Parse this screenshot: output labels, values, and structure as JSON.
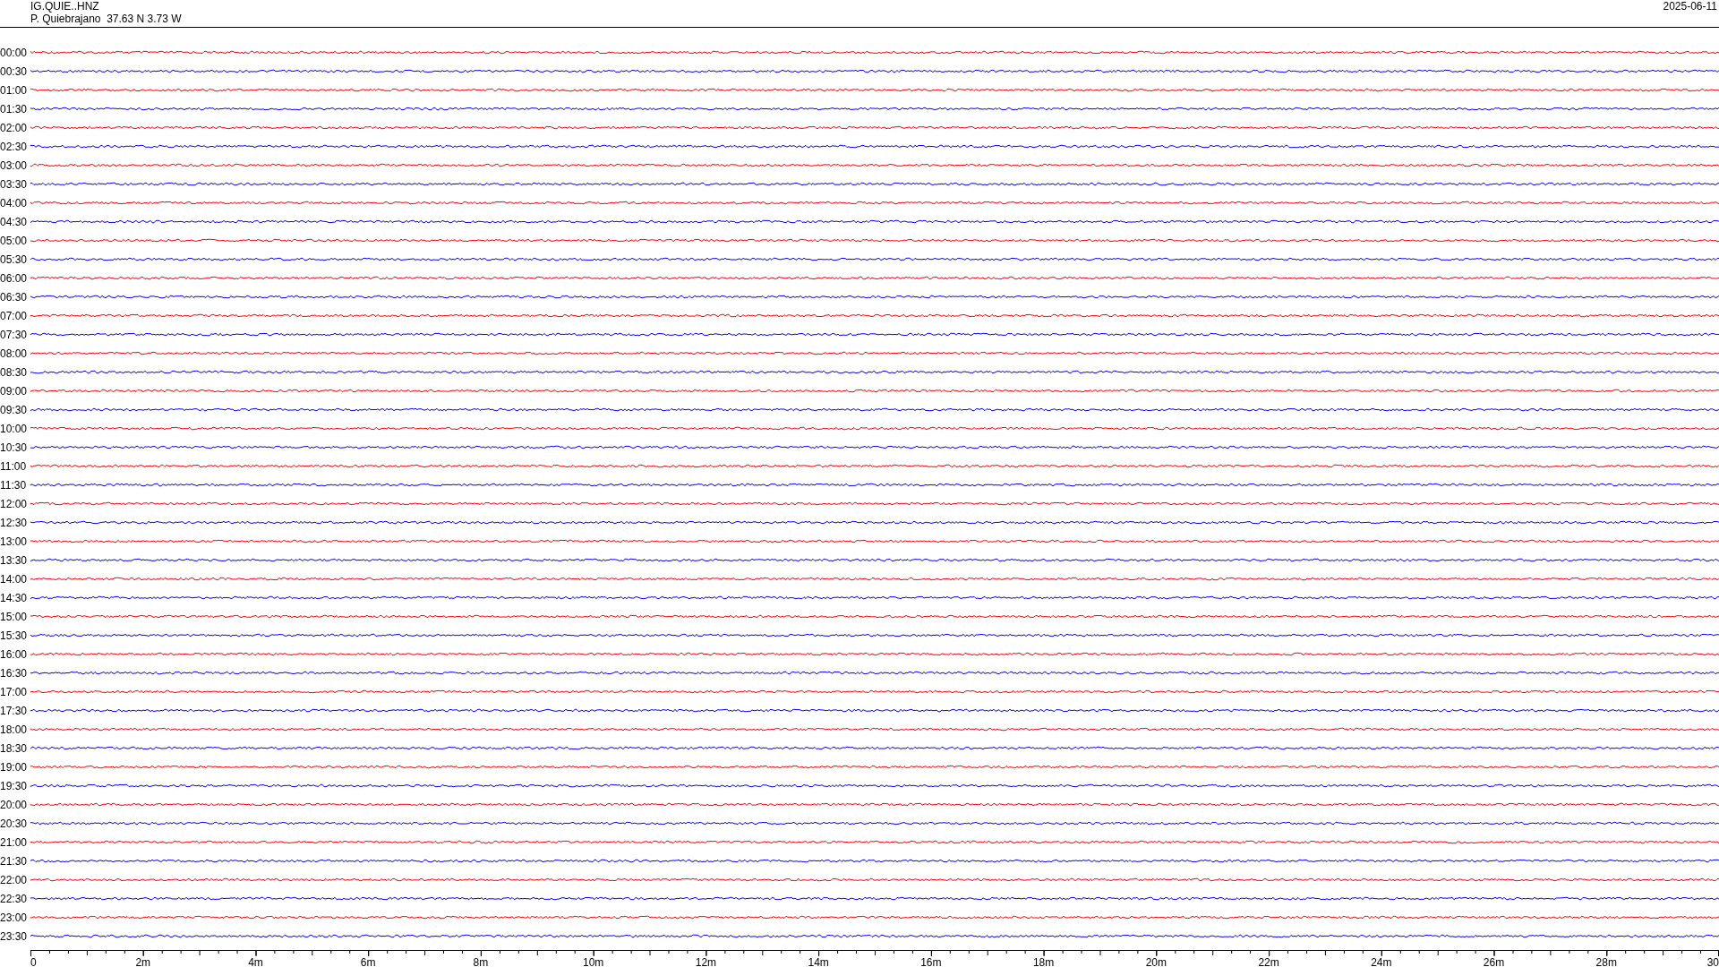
{
  "header": {
    "channel": "IG.QUIE..HNZ",
    "station": "P. Quiebrajano  37.63 N 3.73 W",
    "date": "2025-06-11"
  },
  "traces": [
    {
      "label": "00:00",
      "color": "#ff0000"
    },
    {
      "label": "00:30",
      "color": "#0000ff"
    },
    {
      "label": "01:00",
      "color": "#ff0000"
    },
    {
      "label": "01:30",
      "color": "#0000ff"
    },
    {
      "label": "02:00",
      "color": "#ff0000"
    },
    {
      "label": "02:30",
      "color": "#0000ff"
    },
    {
      "label": "03:00",
      "color": "#ff0000"
    },
    {
      "label": "03:30",
      "color": "#0000ff"
    },
    {
      "label": "04:00",
      "color": "#ff0000"
    },
    {
      "label": "04:30",
      "color": "#0000ff"
    },
    {
      "label": "05:00",
      "color": "#ff0000"
    },
    {
      "label": "05:30",
      "color": "#0000ff"
    },
    {
      "label": "06:00",
      "color": "#ff0000"
    },
    {
      "label": "06:30",
      "color": "#0000ff"
    },
    {
      "label": "07:00",
      "color": "#ff0000"
    },
    {
      "label": "07:30",
      "color": "#0000ff"
    },
    {
      "label": "08:00",
      "color": "#ff0000"
    },
    {
      "label": "08:30",
      "color": "#0000ff"
    },
    {
      "label": "09:00",
      "color": "#ff0000"
    },
    {
      "label": "09:30",
      "color": "#0000ff"
    },
    {
      "label": "10:00",
      "color": "#ff0000"
    },
    {
      "label": "10:30",
      "color": "#0000ff"
    },
    {
      "label": "11:00",
      "color": "#ff0000"
    },
    {
      "label": "11:30",
      "color": "#0000ff"
    },
    {
      "label": "12:00",
      "color": "#ff0000"
    },
    {
      "label": "12:30",
      "color": "#0000ff"
    },
    {
      "label": "13:00",
      "color": "#ff0000"
    },
    {
      "label": "13:30",
      "color": "#0000ff"
    },
    {
      "label": "14:00",
      "color": "#ff0000"
    },
    {
      "label": "14:30",
      "color": "#0000ff"
    },
    {
      "label": "15:00",
      "color": "#ff0000"
    },
    {
      "label": "15:30",
      "color": "#0000ff"
    },
    {
      "label": "16:00",
      "color": "#ff0000"
    },
    {
      "label": "16:30",
      "color": "#0000ff"
    },
    {
      "label": "17:00",
      "color": "#ff0000"
    },
    {
      "label": "17:30",
      "color": "#0000ff"
    },
    {
      "label": "18:00",
      "color": "#ff0000"
    },
    {
      "label": "18:30",
      "color": "#0000ff"
    },
    {
      "label": "19:00",
      "color": "#ff0000"
    },
    {
      "label": "19:30",
      "color": "#0000ff"
    },
    {
      "label": "20:00",
      "color": "#ff0000"
    },
    {
      "label": "20:30",
      "color": "#0000ff"
    },
    {
      "label": "21:00",
      "color": "#ff0000"
    },
    {
      "label": "21:30",
      "color": "#0000ff"
    },
    {
      "label": "22:00",
      "color": "#ff0000"
    },
    {
      "label": "22:30",
      "color": "#0000ff"
    },
    {
      "label": "23:00",
      "color": "#ff0000"
    },
    {
      "label": "23:30",
      "color": "#0000ff"
    }
  ],
  "x_axis": {
    "ticks": [
      "0",
      "2m",
      "4m",
      "6m",
      "8m",
      "10m",
      "12m",
      "14m",
      "16m",
      "18m",
      "20m",
      "22m",
      "24m",
      "26m",
      "28m",
      "30"
    ]
  }
}
